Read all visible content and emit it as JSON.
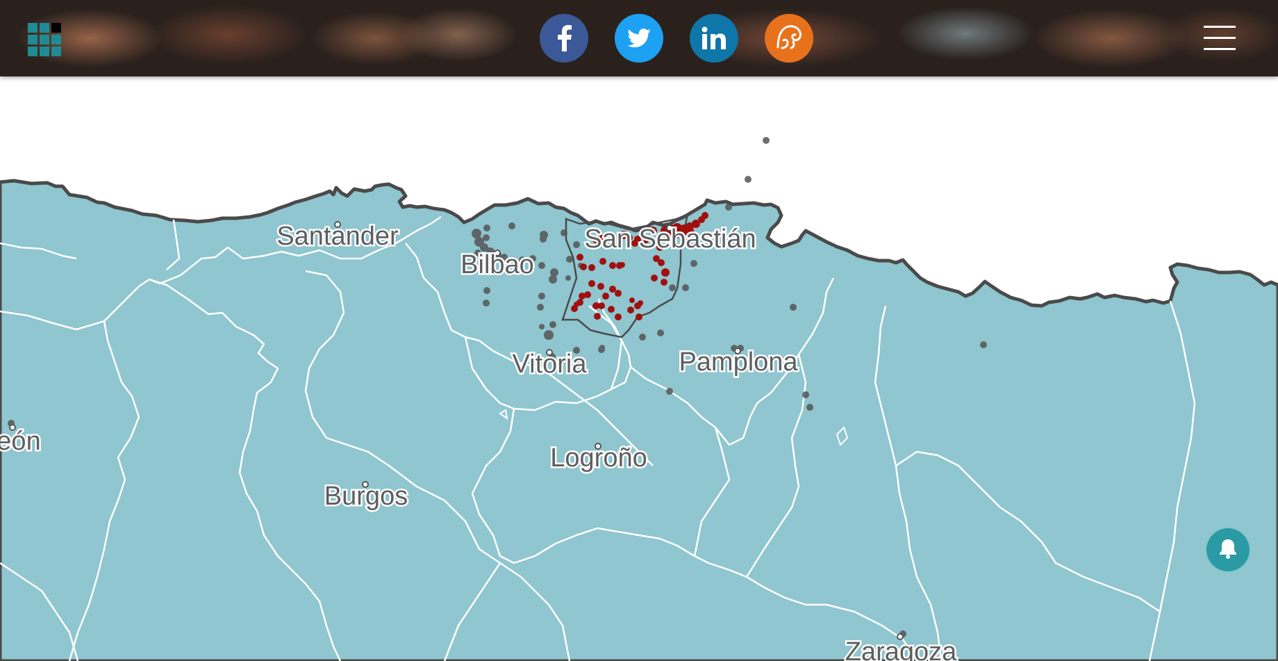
{
  "header": {
    "logo": "grid-logo",
    "social": [
      {
        "name": "facebook",
        "glyph": "f",
        "color": "#3b5998"
      },
      {
        "name": "twitter",
        "glyph": "twitter-bird",
        "color": "#1da1f2"
      },
      {
        "name": "linkedin",
        "glyph": "in",
        "color": "#0e76a8"
      },
      {
        "name": "meneame",
        "glyph": "meneame-logo",
        "color": "#e8711c"
      }
    ],
    "menu_icon": "hamburger-icon"
  },
  "map": {
    "land_color": "#8fc6cf",
    "coast_color": "#4a4a4a",
    "highlight_dot_color": "#a0100e",
    "grey_dot_color": "#555555",
    "cities": [
      {
        "name": "Santander"
      },
      {
        "name": "Bilbao"
      },
      {
        "name": "San Sebastián"
      },
      {
        "name": "Vitoria"
      },
      {
        "name": "Pamplona"
      },
      {
        "name": "Logroño"
      },
      {
        "name": "Burgos"
      },
      {
        "name": "eón"
      },
      {
        "name": "Zaragoza"
      }
    ]
  },
  "notification": {
    "icon": "bell-icon"
  }
}
